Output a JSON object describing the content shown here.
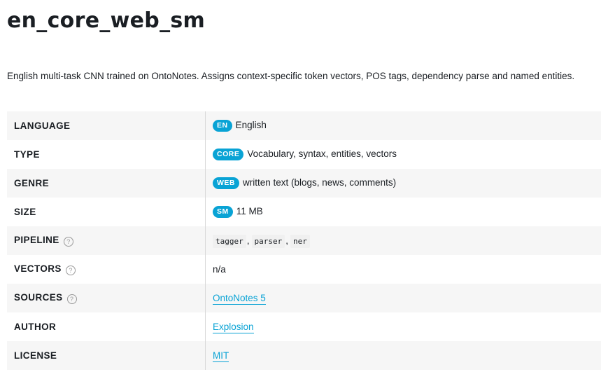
{
  "title": "en_core_web_sm",
  "description": "English multi-task CNN trained on OntoNotes. Assigns context-specific token vectors, POS tags, dependency parse and named entities.",
  "colors": {
    "accent": "#09a3d5",
    "row_alt": "#f6f6f6"
  },
  "rows": {
    "language": {
      "label": "LANGUAGE",
      "badge": "EN",
      "text": "English"
    },
    "type": {
      "label": "TYPE",
      "badge": "CORE",
      "text": "Vocabulary, syntax, entities, vectors"
    },
    "genre": {
      "label": "GENRE",
      "badge": "WEB",
      "text": "written text (blogs, news, comments)"
    },
    "size": {
      "label": "SIZE",
      "badge": "SM",
      "text": "11 MB"
    },
    "pipeline": {
      "label": "PIPELINE",
      "help_icon": "?",
      "components": [
        "tagger",
        "parser",
        "ner"
      ],
      "separator": ","
    },
    "vectors": {
      "label": "VECTORS",
      "help_icon": "?",
      "text": "n/a"
    },
    "sources": {
      "label": "SOURCES",
      "help_icon": "?",
      "link": "OntoNotes 5"
    },
    "author": {
      "label": "AUTHOR",
      "link": "Explosion"
    },
    "license": {
      "label": "LICENSE",
      "link": "MIT"
    }
  }
}
